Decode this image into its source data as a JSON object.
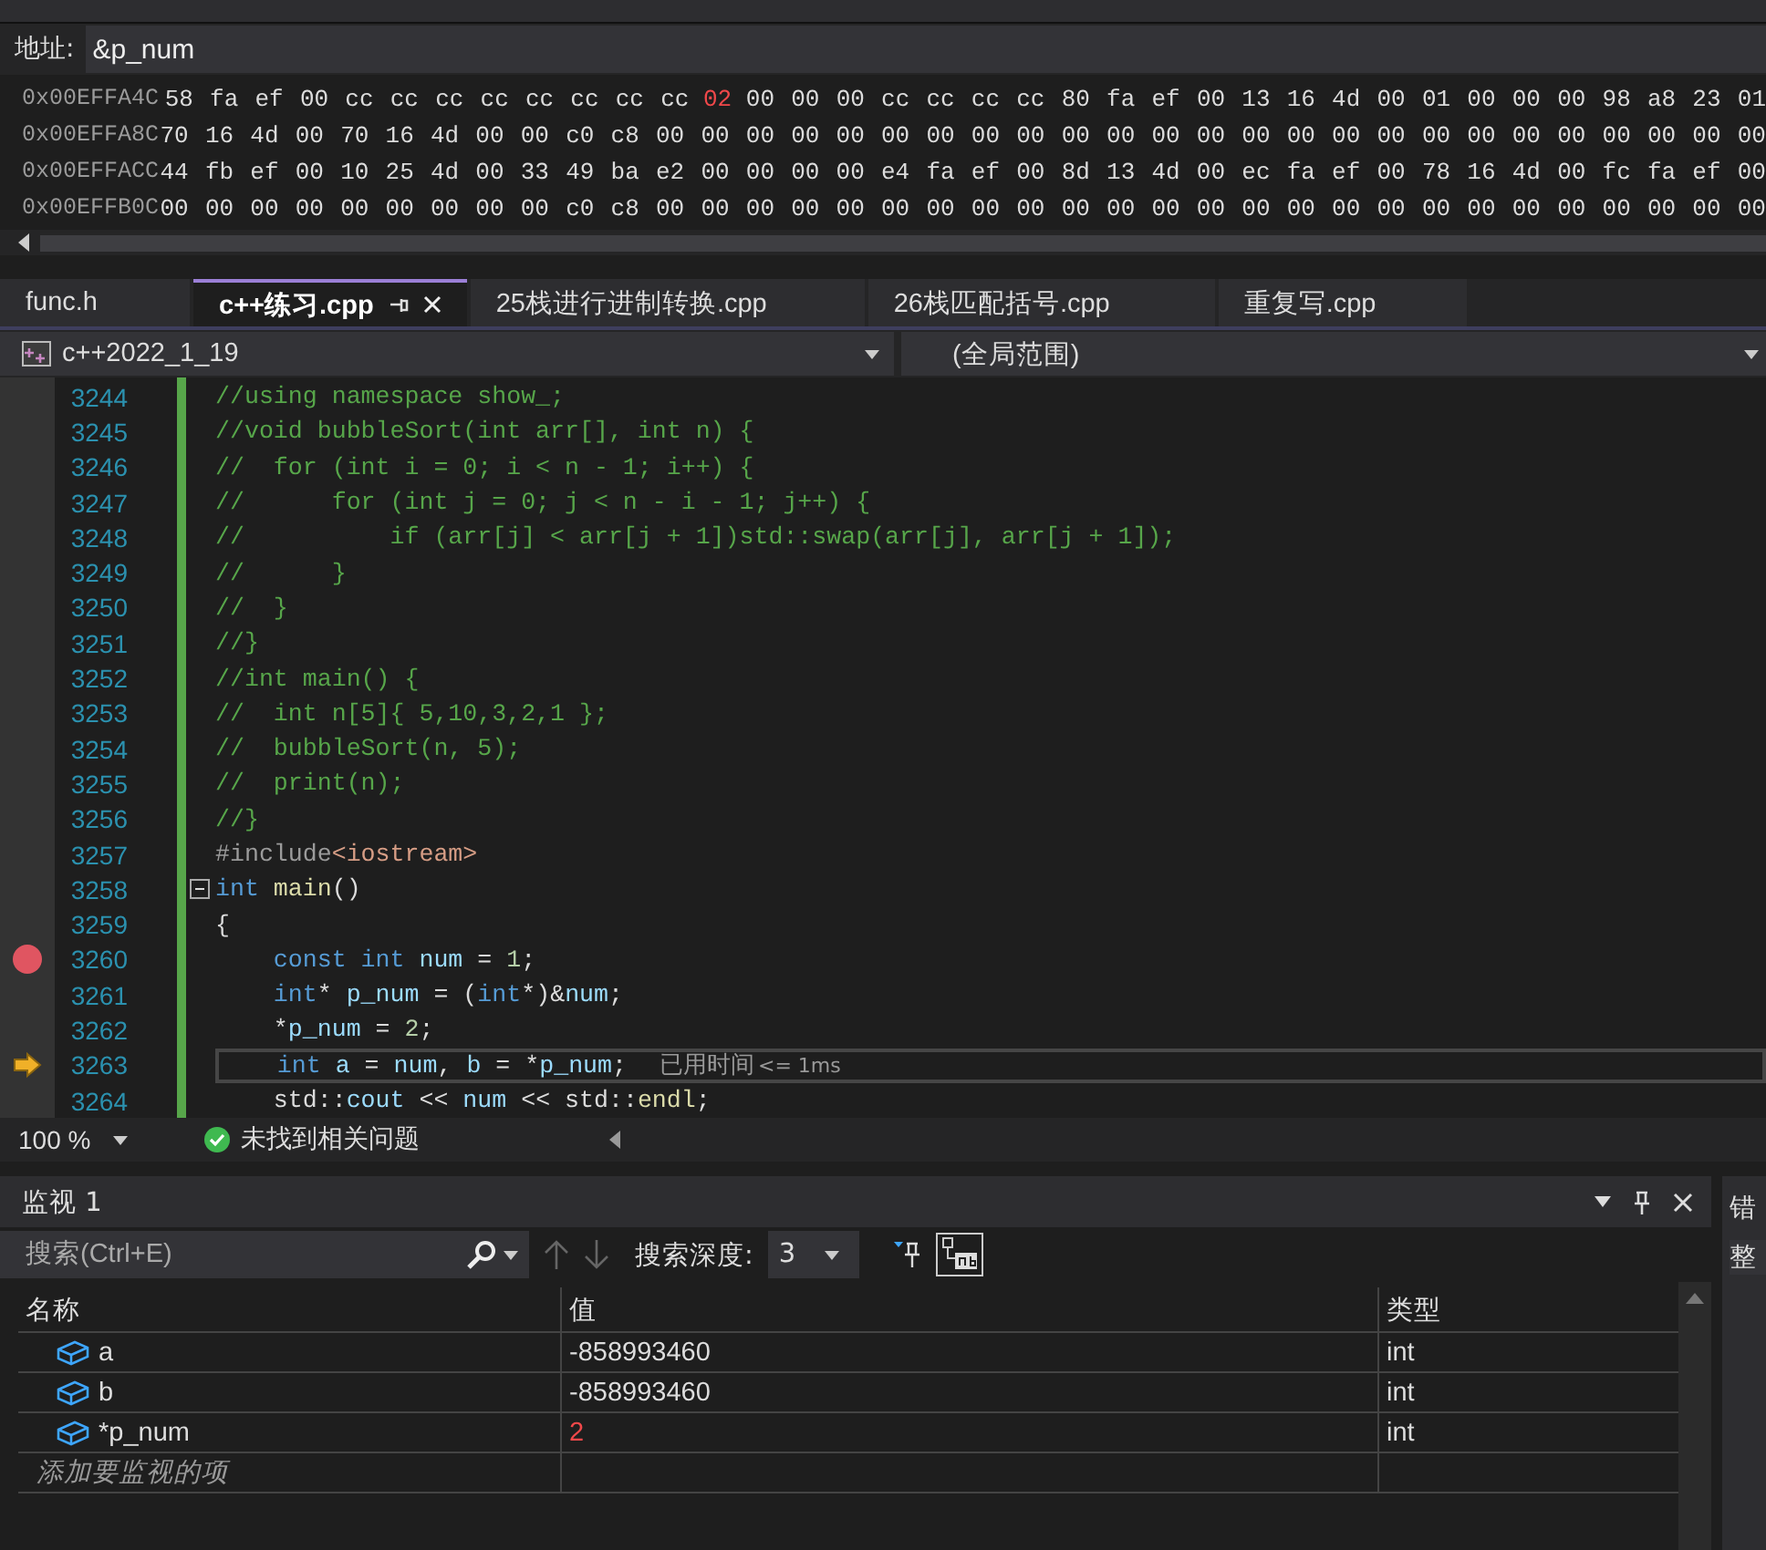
{
  "memory": {
    "address_label": "地址:",
    "address": "&p_num",
    "rows": [
      {
        "address": "0x00EFFA4C",
        "bytes": [
          {
            "text": "58 fa ef 00 cc cc cc cc cc cc cc cc",
            "changed": false
          },
          {
            "text": "02",
            "changed": true
          },
          {
            "text": "00 00 00 cc cc cc cc 80 fa ef 00 13 16 4d 00 01 00 00 00 98 a8 23 01",
            "changed": false
          }
        ]
      },
      {
        "address": "0x00EFFA8C",
        "bytes": [
          {
            "text": "70 16 4d 00 70 16 4d 00 00 c0 c8 00 00 00 00 00 00 00 00 00 00 00 00 00 00 00 00 00 00 00 00 00 00 00 00 00",
            "changed": false
          }
        ]
      },
      {
        "address": "0x00EFFACC",
        "bytes": [
          {
            "text": "44 fb ef 00 10 25 4d 00 33 49 ba e2 00 00 00 00 e4 fa ef 00 8d 13 4d 00 ec fa ef 00 78 16 4d 00 fc fa ef 00",
            "changed": false
          }
        ]
      },
      {
        "address": "0x00EFFB0C",
        "bytes": [
          {
            "text": "00 00 00 00 00 00 00 00 00 c0 c8 00 00 00 00 00 00 00 00 00 00 00 00 00 00 00 00 00 00 00 00 00 00 00 00 00",
            "changed": false
          }
        ]
      }
    ]
  },
  "tabs": [
    {
      "label": "func.h",
      "selected": false
    },
    {
      "label": "c++练习.cpp",
      "selected": true
    },
    {
      "label": "25栈进行进制转换.cpp",
      "selected": false
    },
    {
      "label": "26栈匹配括号.cpp",
      "selected": false
    },
    {
      "label": "重复写.cpp",
      "selected": false
    }
  ],
  "navigation": {
    "project": "c++2022_1_19",
    "scope": "(全局范围)"
  },
  "editor": {
    "lines": [
      {
        "number": "3244",
        "tokens": [
          {
            "text": "//using namespace show_;",
            "kind": "comment"
          }
        ]
      },
      {
        "number": "3245",
        "tokens": [
          {
            "text": "//void bubbleSort(int arr[], int n) {",
            "kind": "comment"
          }
        ]
      },
      {
        "number": "3246",
        "tokens": [
          {
            "text": "//  for (int i = 0; i < n - 1; i++) {",
            "kind": "comment"
          }
        ]
      },
      {
        "number": "3247",
        "tokens": [
          {
            "text": "//      for (int j = 0; j < n - i - 1; j++) {",
            "kind": "comment"
          }
        ]
      },
      {
        "number": "3248",
        "tokens": [
          {
            "text": "//          if (arr[j] < arr[j + 1])std::swap(arr[j], arr[j + 1]);",
            "kind": "comment"
          }
        ]
      },
      {
        "number": "3249",
        "tokens": [
          {
            "text": "//      }",
            "kind": "comment"
          }
        ]
      },
      {
        "number": "3250",
        "tokens": [
          {
            "text": "//  }",
            "kind": "comment"
          }
        ]
      },
      {
        "number": "3251",
        "tokens": [
          {
            "text": "//}",
            "kind": "comment"
          }
        ]
      },
      {
        "number": "3252",
        "tokens": [
          {
            "text": "//int main() {",
            "kind": "comment"
          }
        ]
      },
      {
        "number": "3253",
        "tokens": [
          {
            "text": "//  int n[5]{ 5,10,3,2,1 };",
            "kind": "comment"
          }
        ]
      },
      {
        "number": "3254",
        "tokens": [
          {
            "text": "//  bubbleSort(n, 5);",
            "kind": "comment"
          }
        ]
      },
      {
        "number": "3255",
        "tokens": [
          {
            "text": "//  print(n);",
            "kind": "comment"
          }
        ]
      },
      {
        "number": "3256",
        "tokens": [
          {
            "text": "//}",
            "kind": "comment"
          }
        ]
      },
      {
        "number": "3257",
        "tokens": [
          {
            "text": "#include",
            "kind": "preproc"
          },
          {
            "text": "<iostream>",
            "kind": "string"
          }
        ]
      },
      {
        "number": "3258",
        "foldable": true,
        "tokens": [
          {
            "text": "int ",
            "kind": "keyword"
          },
          {
            "text": "main",
            "kind": "function"
          },
          {
            "text": "()",
            "kind": "plain"
          }
        ]
      },
      {
        "number": "3259",
        "tokens": [
          {
            "text": "{",
            "kind": "plain"
          }
        ]
      },
      {
        "number": "3260",
        "breakpoint": true,
        "tokens": [
          {
            "text": "    const int ",
            "kind": "keyword"
          },
          {
            "text": "num",
            "kind": "variable"
          },
          {
            "text": " = ",
            "kind": "plain"
          },
          {
            "text": "1",
            "kind": "number"
          },
          {
            "text": ";",
            "kind": "plain"
          }
        ]
      },
      {
        "number": "3261",
        "tokens": [
          {
            "text": "    int",
            "kind": "keyword"
          },
          {
            "text": "* ",
            "kind": "plain"
          },
          {
            "text": "p_num",
            "kind": "variable"
          },
          {
            "text": " = (",
            "kind": "plain"
          },
          {
            "text": "int",
            "kind": "keyword"
          },
          {
            "text": "*)&",
            "kind": "plain"
          },
          {
            "text": "num",
            "kind": "variable"
          },
          {
            "text": ";",
            "kind": "plain"
          }
        ]
      },
      {
        "number": "3262",
        "tokens": [
          {
            "text": "    *",
            "kind": "plain"
          },
          {
            "text": "p_num",
            "kind": "variable"
          },
          {
            "text": " = ",
            "kind": "plain"
          },
          {
            "text": "2",
            "kind": "number"
          },
          {
            "text": ";",
            "kind": "plain"
          }
        ]
      },
      {
        "number": "3263",
        "current": true,
        "hint": "已用时间",
        "hint_value": "<= 1ms",
        "tokens": [
          {
            "text": "    int ",
            "kind": "keyword"
          },
          {
            "text": "a",
            "kind": "variable"
          },
          {
            "text": " = ",
            "kind": "plain"
          },
          {
            "text": "num",
            "kind": "variable"
          },
          {
            "text": ", ",
            "kind": "plain"
          },
          {
            "text": "b",
            "kind": "variable"
          },
          {
            "text": " = *",
            "kind": "plain"
          },
          {
            "text": "p_num",
            "kind": "variable"
          },
          {
            "text": ";",
            "kind": "plain"
          }
        ]
      },
      {
        "number": "3264",
        "tokens": [
          {
            "text": "    std::",
            "kind": "plain"
          },
          {
            "text": "cout",
            "kind": "variable"
          },
          {
            "text": " << ",
            "kind": "plain"
          },
          {
            "text": "num",
            "kind": "variable"
          },
          {
            "text": " << std::",
            "kind": "plain"
          },
          {
            "text": "endl",
            "kind": "function"
          },
          {
            "text": ";",
            "kind": "plain"
          }
        ]
      }
    ]
  },
  "status": {
    "zoom": "100 %",
    "issues": "未找到相关问题"
  },
  "watch": {
    "title": "监视 1",
    "search_placeholder": "搜索(Ctrl+E)",
    "depth_label": "搜索深度:",
    "depth": "3",
    "columns": [
      "名称",
      "值",
      "类型"
    ],
    "rows": [
      {
        "name": "a",
        "value": "-858993460",
        "type": "int",
        "changed": false
      },
      {
        "name": "b",
        "value": "-858993460",
        "type": "int",
        "changed": false
      },
      {
        "name": "*p_num",
        "value": "2",
        "type": "int",
        "changed": true
      }
    ],
    "add_placeholder": "添加要监视的项"
  },
  "side_panel": {
    "title": "错",
    "field": "整"
  }
}
